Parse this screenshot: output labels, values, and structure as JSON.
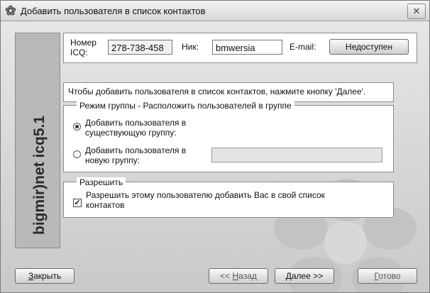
{
  "window": {
    "title": "Добавить пользователя в список контактов",
    "close_label": "✕"
  },
  "sidebar": {
    "logo_text": "bigmir)net icq5.1"
  },
  "user_info": {
    "icq_label_line1": "Номер",
    "icq_label_line2": "ICQ:",
    "icq_number": "278-738-458",
    "nick_label": "Ник:",
    "nick_value": "bmwersia",
    "email_label": "E-mail:",
    "email_value": "Недоступен"
  },
  "instruction": "Чтобы добавить пользователя в список контактов, нажмите кнопку 'Далее'.",
  "group_mode": {
    "legend": "Режим группы - Расположить пользователей в группе",
    "existing_line1": "Добавить пользователя в",
    "existing_line2": "существующую группу:",
    "new_line1": "Добавить пользователя в",
    "new_line2": "новую группу:",
    "new_group_value": "",
    "selected": "existing"
  },
  "permission": {
    "legend": "Разрешить",
    "allow_line1": "Разрешить этому пользователю добавить Вас в свой список",
    "allow_line2": "контактов",
    "checked_mark": "✓"
  },
  "buttons": {
    "close_hot": "З",
    "close_rest": "акрыть",
    "back_pre": "<< ",
    "back_hot": "Н",
    "back_rest": "азад",
    "next_hot": "Д",
    "next_rest": "алее >>",
    "done_hot": "Г",
    "done_rest": "отово"
  }
}
